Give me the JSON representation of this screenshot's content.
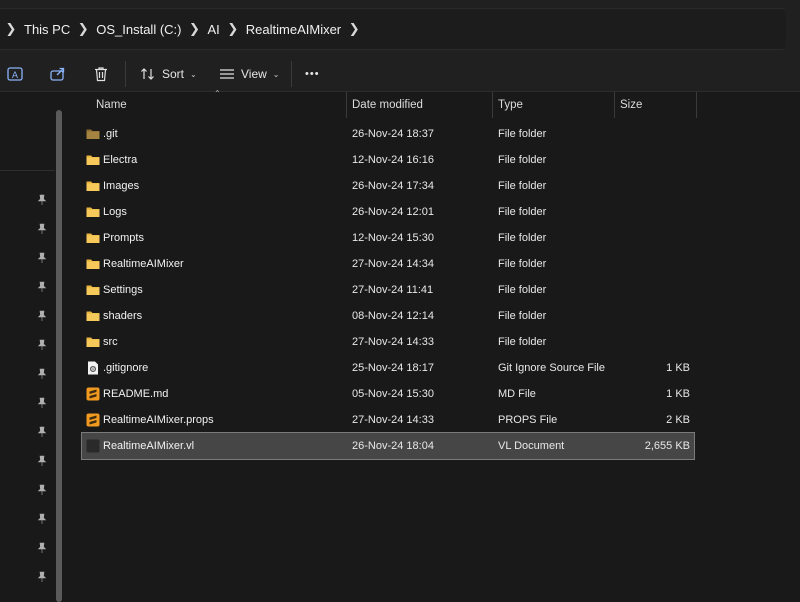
{
  "address": {
    "crumbs": [
      "This PC",
      "OS_Install (C:)",
      "AI",
      "RealtimeAIMixer"
    ]
  },
  "toolbar": {
    "sort_label": "Sort",
    "view_label": "View",
    "more_label": "•••"
  },
  "columns": {
    "name": "Name",
    "date": "Date modified",
    "type": "Type",
    "size": "Size"
  },
  "files": [
    {
      "name": ".git",
      "date": "26-Nov-24 18:37",
      "type": "File folder",
      "size": "",
      "icon": "folder-dark-icon"
    },
    {
      "name": "Electra",
      "date": "12-Nov-24 16:16",
      "type": "File folder",
      "size": "",
      "icon": "folder-icon"
    },
    {
      "name": "Images",
      "date": "26-Nov-24 17:34",
      "type": "File folder",
      "size": "",
      "icon": "folder-icon"
    },
    {
      "name": "Logs",
      "date": "26-Nov-24 12:01",
      "type": "File folder",
      "size": "",
      "icon": "folder-icon"
    },
    {
      "name": "Prompts",
      "date": "12-Nov-24 15:30",
      "type": "File folder",
      "size": "",
      "icon": "folder-icon"
    },
    {
      "name": "RealtimeAIMixer",
      "date": "27-Nov-24 14:34",
      "type": "File folder",
      "size": "",
      "icon": "folder-icon"
    },
    {
      "name": "Settings",
      "date": "27-Nov-24 11:41",
      "type": "File folder",
      "size": "",
      "icon": "folder-icon"
    },
    {
      "name": "shaders",
      "date": "08-Nov-24 12:14",
      "type": "File folder",
      "size": "",
      "icon": "folder-icon"
    },
    {
      "name": "src",
      "date": "27-Nov-24 14:33",
      "type": "File folder",
      "size": "",
      "icon": "folder-icon"
    },
    {
      "name": ".gitignore",
      "date": "25-Nov-24 18:17",
      "type": "Git Ignore Source File",
      "size": "1 KB",
      "icon": "gear-file-icon"
    },
    {
      "name": "README.md",
      "date": "05-Nov-24 15:30",
      "type": "MD File",
      "size": "1 KB",
      "icon": "sublime-file-icon"
    },
    {
      "name": "RealtimeAIMixer.props",
      "date": "27-Nov-24 14:33",
      "type": "PROPS File",
      "size": "2 KB",
      "icon": "sublime-file-icon"
    },
    {
      "name": "RealtimeAIMixer.vl",
      "date": "26-Nov-24 18:04",
      "type": "VL Document",
      "size": "2,655 KB",
      "icon": "vl-file-icon",
      "selected": true
    }
  ],
  "colors": {
    "background": "#191919",
    "chrome": "#202020",
    "folder": "#f2c14a",
    "selection": "#464646",
    "sublime": "#f29a1f"
  }
}
